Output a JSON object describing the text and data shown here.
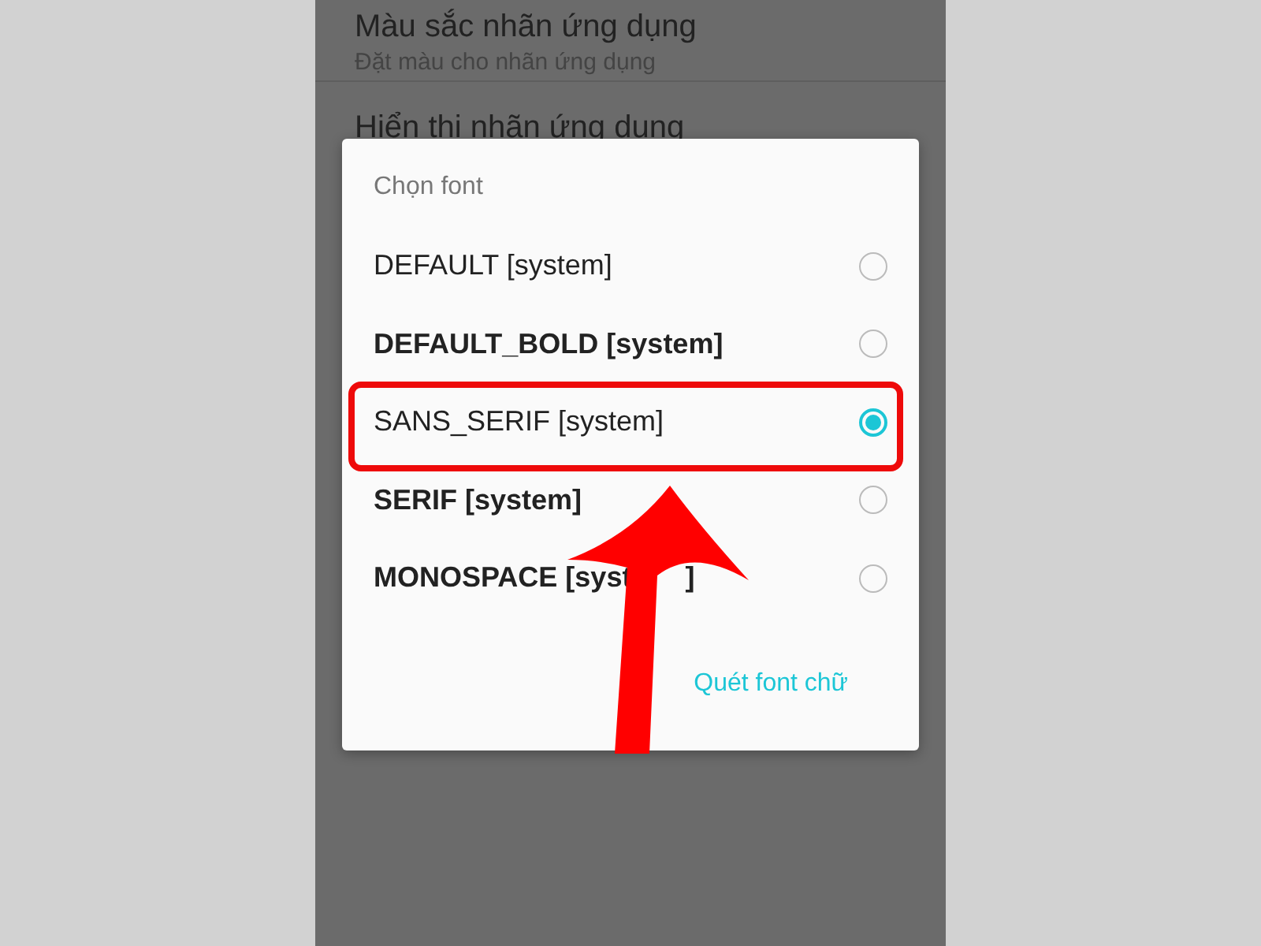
{
  "background_settings": [
    {
      "title": "Màu sắc nhãn ứng dụng",
      "subtitle": "Đặt màu cho nhãn ứng dụng"
    },
    {
      "title": "Hiển thị nhãn ứng dụng"
    }
  ],
  "dialog": {
    "title": "Chọn font",
    "options": [
      {
        "label": "DEFAULT [system]",
        "bold": false,
        "selected": false,
        "annotated": false
      },
      {
        "label": "DEFAULT_BOLD [system]",
        "bold": true,
        "selected": false,
        "annotated": false
      },
      {
        "label": "SANS_SERIF [system]",
        "bold": false,
        "selected": true,
        "annotated": true
      },
      {
        "label": "SERIF [system]",
        "bold": true,
        "selected": false,
        "annotated": false
      },
      {
        "label": "MONOSPACE [syst",
        "label_end": "]",
        "bold": true,
        "selected": false,
        "annotated": false
      }
    ],
    "action": "Quét font chữ"
  }
}
